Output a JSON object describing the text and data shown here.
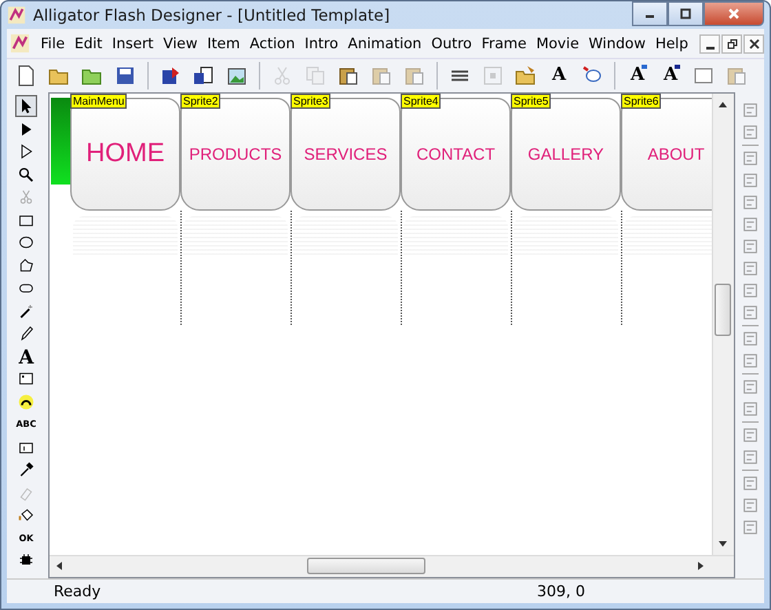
{
  "window": {
    "title": "Alligator Flash Designer - [Untitled Template]"
  },
  "menu": [
    "File",
    "Edit",
    "Insert",
    "View",
    "Item",
    "Action",
    "Intro",
    "Animation",
    "Outro",
    "Frame",
    "Movie",
    "Window",
    "Help"
  ],
  "toolbar": [
    {
      "kind": "page",
      "disabled": false
    },
    {
      "kind": "folder",
      "disabled": false
    },
    {
      "kind": "folder-green",
      "disabled": false
    },
    {
      "kind": "disk",
      "disabled": false
    },
    {
      "kind": "sep"
    },
    {
      "kind": "export",
      "disabled": false
    },
    {
      "kind": "export-page",
      "disabled": false
    },
    {
      "kind": "picture-import",
      "disabled": false
    },
    {
      "kind": "sep"
    },
    {
      "kind": "scissors",
      "disabled": true
    },
    {
      "kind": "copy",
      "disabled": true
    },
    {
      "kind": "paste",
      "disabled": false
    },
    {
      "kind": "paste",
      "disabled": true
    },
    {
      "kind": "paste",
      "disabled": true
    },
    {
      "kind": "sep"
    },
    {
      "kind": "lines",
      "disabled": false
    },
    {
      "kind": "grid",
      "disabled": true
    },
    {
      "kind": "folder-edit",
      "disabled": false
    },
    {
      "kind": "letter",
      "label": "A",
      "disabled": false
    },
    {
      "kind": "balloon",
      "disabled": false
    },
    {
      "kind": "sep"
    },
    {
      "kind": "letter-up",
      "label": "A",
      "disabled": false
    },
    {
      "kind": "letter-down",
      "label": "A",
      "disabled": false
    },
    {
      "kind": "frame",
      "disabled": false
    },
    {
      "kind": "paste",
      "disabled": true
    }
  ],
  "toolbox": [
    {
      "kind": "pointer",
      "selected": true
    },
    {
      "kind": "pointer-solid",
      "selected": false
    },
    {
      "kind": "pointer-hollow",
      "selected": false
    },
    {
      "kind": "zoom",
      "selected": false
    },
    {
      "kind": "scissors",
      "selected": false
    },
    {
      "kind": "rect",
      "selected": false
    },
    {
      "kind": "ellipse",
      "selected": false
    },
    {
      "kind": "polygon",
      "selected": false
    },
    {
      "kind": "rounded",
      "selected": false
    },
    {
      "kind": "wand",
      "selected": false
    },
    {
      "kind": "pencil",
      "selected": false
    },
    {
      "kind": "letter",
      "label": "A",
      "selected": false
    },
    {
      "kind": "textbox",
      "selected": false
    },
    {
      "kind": "arc",
      "selected": false
    },
    {
      "kind": "word",
      "label": "ABC",
      "selected": false
    },
    {
      "kind": "input",
      "selected": false
    },
    {
      "kind": "dropper",
      "selected": false
    },
    {
      "kind": "eraser",
      "selected": false
    },
    {
      "kind": "bucket",
      "selected": false
    },
    {
      "kind": "word",
      "label": "OK",
      "selected": false
    },
    {
      "kind": "bug",
      "selected": false
    }
  ],
  "canvas": {
    "buttons": [
      {
        "tag": "MainMenu",
        "label": "HOME",
        "kind": "featured"
      },
      {
        "tag": "Sprite2",
        "label": "PRODUCTS",
        "kind": "item"
      },
      {
        "tag": "Sprite3",
        "label": "SERVICES",
        "kind": "item"
      },
      {
        "tag": "Sprite4",
        "label": "CONTACT",
        "kind": "item"
      },
      {
        "tag": "Sprite5",
        "label": "GALLERY",
        "kind": "item"
      },
      {
        "tag": "Sprite6",
        "label": "ABOUT",
        "kind": "item"
      }
    ]
  },
  "status_bar": {
    "message": "Ready",
    "position": "309, 0"
  }
}
